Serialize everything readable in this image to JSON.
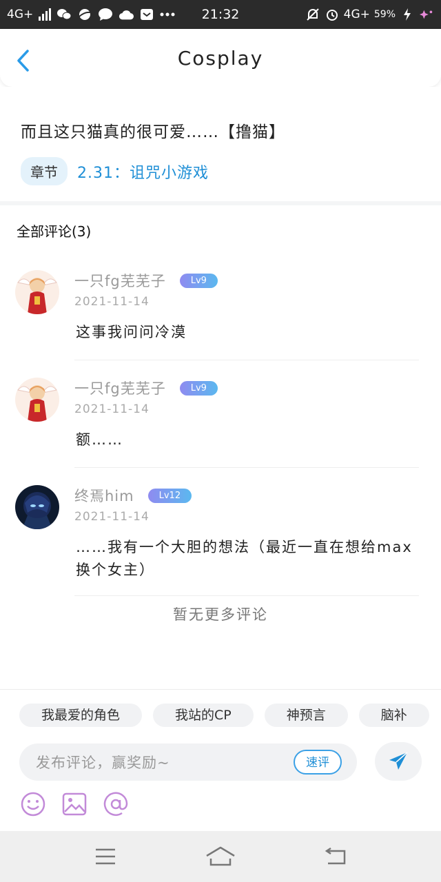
{
  "status_bar": {
    "network_left": "4G+",
    "time": "21:32",
    "network_right": "4G+",
    "battery": "59%"
  },
  "header": {
    "title": "Cosplay"
  },
  "post": {
    "text": "而且这只猫真的很可爱……【撸猫】",
    "chapter_tag": "章节",
    "chapter_link": "2.31：诅咒小游戏"
  },
  "comments_section": {
    "header": "全部评论(3)",
    "items": [
      {
        "name": "一只fg芜芜子",
        "level": "Lv9",
        "date": "2021-11-14",
        "text": "这事我问问冷漠"
      },
      {
        "name": "一只fg芜芜子",
        "level": "Lv9",
        "date": "2021-11-14",
        "text": "额……"
      },
      {
        "name": "终焉him",
        "level": "Lv12",
        "date": "2021-11-14",
        "text": "……我有一个大胆的想法（最近一直在想给max换个女主）"
      }
    ],
    "no_more": "暂无更多评论"
  },
  "bottom": {
    "chips": [
      "我最爱的角色",
      "我站的CP",
      "神预言",
      "脑补"
    ],
    "input_placeholder": "发布评论，赢奖励~",
    "quick_comment": "速评"
  },
  "colors": {
    "accent": "#1f8fd6",
    "badge_gradient_start": "#8f8bf0",
    "badge_gradient_end": "#5bb8ef",
    "tool_icon": "#c28ad8",
    "status_bar_bg": "#2b2b2b"
  },
  "icons": {
    "back": "chevron-left-icon",
    "send": "paper-plane-icon",
    "emoji": "smiley-icon",
    "image": "image-icon",
    "mention": "at-icon"
  }
}
